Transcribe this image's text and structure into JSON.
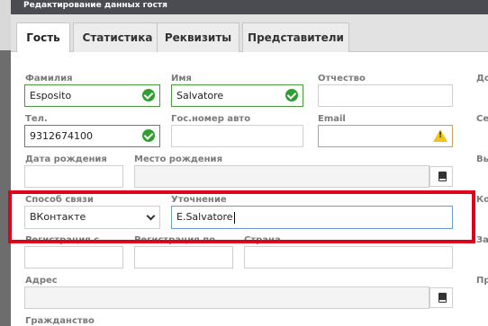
{
  "window": {
    "title": "Редактирование данных гостя"
  },
  "tabs": [
    {
      "label": "Гость",
      "active": true
    },
    {
      "label": "Статистика",
      "active": false
    },
    {
      "label": "Реквизиты",
      "active": false
    },
    {
      "label": "Представители",
      "active": false
    }
  ],
  "form": {
    "surname": {
      "label": "Фамилия",
      "value": "Esposito",
      "status": "valid"
    },
    "first_name": {
      "label": "Имя",
      "value": "Salvatore",
      "status": "valid"
    },
    "patronymic": {
      "label": "Отчество",
      "value": ""
    },
    "phone": {
      "label": "Тел.",
      "value": "9312674100",
      "status": "valid"
    },
    "car_plate": {
      "label": "Гос.номер авто",
      "value": ""
    },
    "email": {
      "label": "Email",
      "value": "",
      "status": "warning"
    },
    "birth_date": {
      "label": "Дата рождения",
      "value": ""
    },
    "birth_place": {
      "label": "Место рождения",
      "value": ""
    },
    "contact_method": {
      "label": "Способ связи",
      "value": "ВКонтакте"
    },
    "contact_detail": {
      "label": "Уточнение",
      "value": "E.Salvatore"
    },
    "registration_from": {
      "label": "Регистрация с",
      "value": ""
    },
    "registration_to": {
      "label": "Регистрация по",
      "value": ""
    },
    "country": {
      "label": "Страна",
      "value": ""
    },
    "address": {
      "label": "Адрес",
      "value": ""
    },
    "citizenship": {
      "label": "Гражданство"
    }
  },
  "right_column_labels": [
    "До",
    "Се",
    "Вы",
    "Ко",
    "За",
    "Пр"
  ],
  "colors": {
    "title_bar": "#4a4c51",
    "highlight": "#e0001a",
    "valid": "#2f9f2f",
    "warning": "#f0c419"
  }
}
